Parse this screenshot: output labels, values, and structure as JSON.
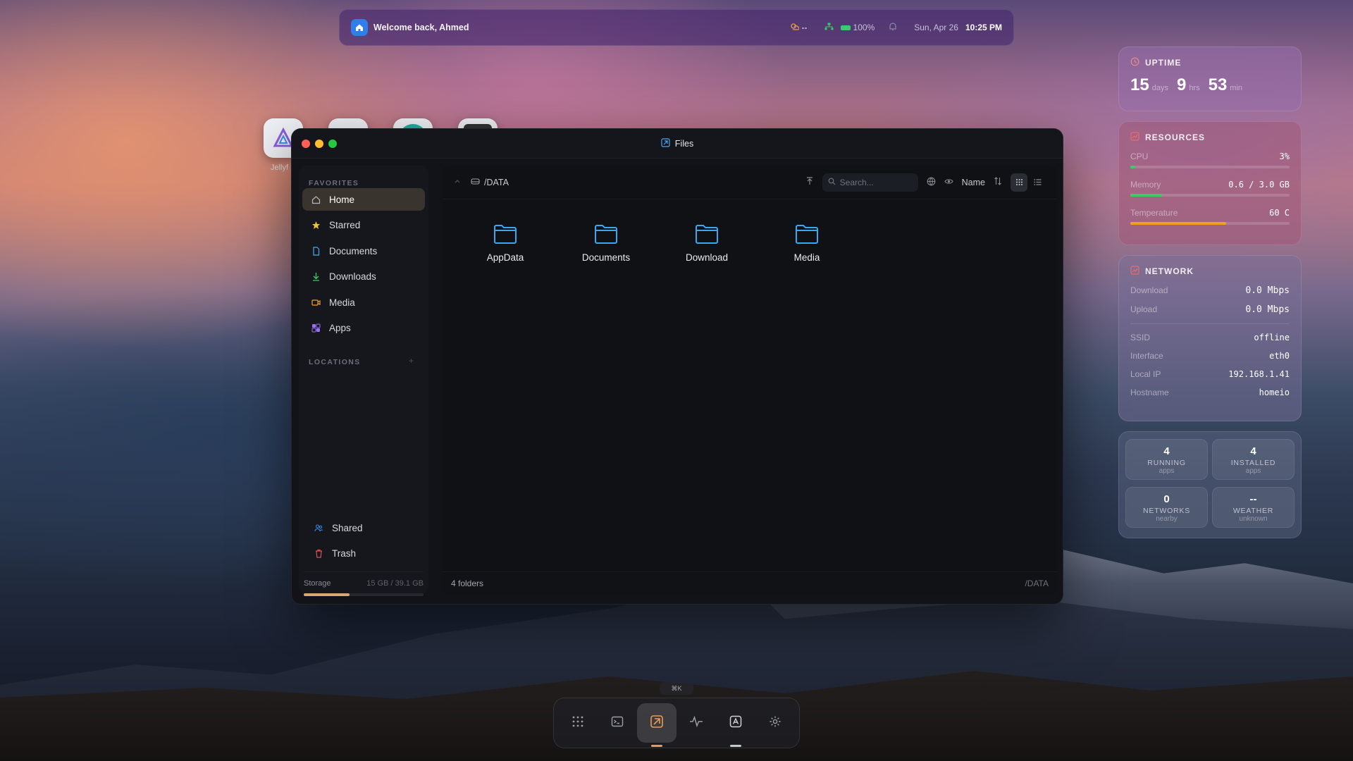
{
  "topbar": {
    "welcome": "Welcome back, Ahmed",
    "weather": "--",
    "battery": "100%",
    "date": "Sun, Apr 26",
    "time": "10:25 PM"
  },
  "desktop": {
    "icon_label": "Jellyf"
  },
  "window": {
    "title": "Files"
  },
  "sidebar": {
    "favorites_label": "FAVORITES",
    "items": [
      {
        "label": "Home"
      },
      {
        "label": "Starred"
      },
      {
        "label": "Documents"
      },
      {
        "label": "Downloads"
      },
      {
        "label": "Media"
      },
      {
        "label": "Apps"
      }
    ],
    "locations_label": "LOCATIONS",
    "shared": "Shared",
    "trash": "Trash",
    "storage_label": "Storage",
    "storage_value": "15 GB / 39.1 GB",
    "storage_fraction": 0.38
  },
  "toolbar": {
    "path": "/DATA",
    "search_placeholder": "Search...",
    "sort_label": "Name"
  },
  "folders": [
    {
      "name": "AppData"
    },
    {
      "name": "Documents"
    },
    {
      "name": "Download"
    },
    {
      "name": "Media"
    }
  ],
  "status": {
    "count": "4 folders",
    "path": "/DATA"
  },
  "uptime": {
    "title": "UPTIME",
    "days": "15",
    "days_unit": "days",
    "hrs": "9",
    "hrs_unit": "hrs",
    "min": "53",
    "min_unit": "min"
  },
  "resources": {
    "title": "RESOURCES",
    "cpu_label": "CPU",
    "cpu_value": "3%",
    "cpu_fraction": 0.03,
    "mem_label": "Memory",
    "mem_value": "0.6 / 3.0 GB",
    "mem_fraction": 0.2,
    "temp_label": "Temperature",
    "temp_value": "60 C",
    "temp_fraction": 0.6
  },
  "network": {
    "title": "NETWORK",
    "download_label": "Download",
    "download_value": "0.0 Mbps",
    "upload_label": "Upload",
    "upload_value": "0.0 Mbps",
    "ssid_label": "SSID",
    "ssid_value": "offline",
    "iface_label": "Interface",
    "iface_value": "eth0",
    "ip_label": "Local IP",
    "ip_value": "192.168.1.41",
    "host_label": "Hostname",
    "host_value": "homeio"
  },
  "stats": [
    {
      "number": "4",
      "label": "RUNNING",
      "sub": "apps"
    },
    {
      "number": "4",
      "label": "INSTALLED",
      "sub": "apps"
    },
    {
      "number": "0",
      "label": "NETWORKS",
      "sub": "nearby"
    },
    {
      "number": "--",
      "label": "WEATHER",
      "sub": "unknown"
    }
  ],
  "dock": {
    "hint": "⌘K"
  },
  "colors": {
    "accent": "#e89a5a",
    "folder": "#3aa8f0",
    "green": "#3ec96a",
    "temp": "#f0a020"
  }
}
